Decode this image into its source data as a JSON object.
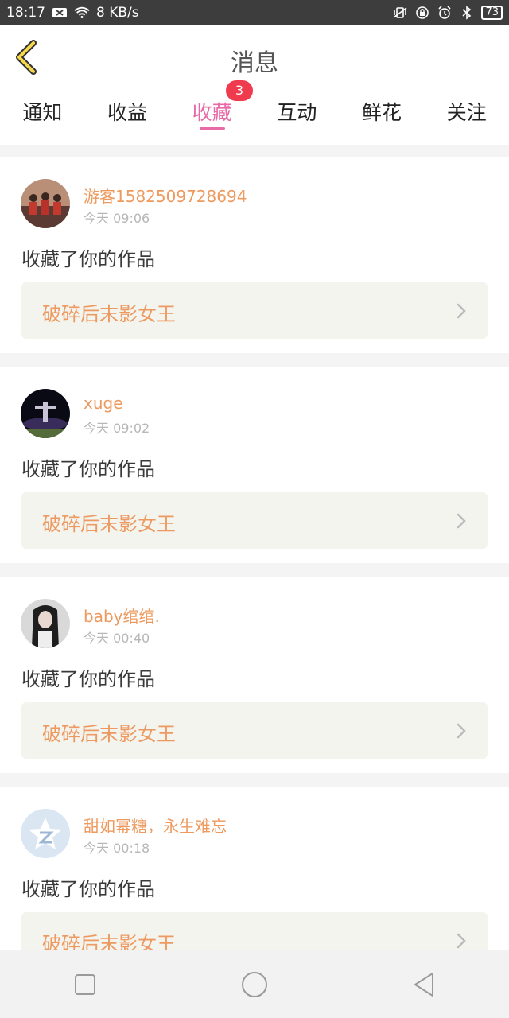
{
  "status_bar": {
    "time": "18:17",
    "speed": "8 KB/s",
    "battery": "73"
  },
  "header": {
    "title": "消息"
  },
  "tabs": [
    {
      "label": "通知"
    },
    {
      "label": "收益"
    },
    {
      "label": "收藏",
      "badge": "3",
      "active": true
    },
    {
      "label": "互动"
    },
    {
      "label": "鲜花"
    },
    {
      "label": "关注"
    }
  ],
  "messages": [
    {
      "username": "游客1582509728694",
      "time": "今天 09:06",
      "action": "收藏了你的作品",
      "work_title": "破碎后末影女王"
    },
    {
      "username": "xuge",
      "time": "今天 09:02",
      "action": "收藏了你的作品",
      "work_title": "破碎后末影女王"
    },
    {
      "username": "baby绾绾.",
      "time": "今天 00:40",
      "action": "收藏了你的作品",
      "work_title": "破碎后末影女王"
    },
    {
      "username": "甜如幂糖，永生难忘",
      "time": "今天 00:18",
      "action": "收藏了你的作品",
      "work_title": "破碎后末影女王"
    }
  ],
  "colors": {
    "accent": "#e86aa6",
    "username": "#ee9a5e",
    "badge": "#f03a4e"
  }
}
